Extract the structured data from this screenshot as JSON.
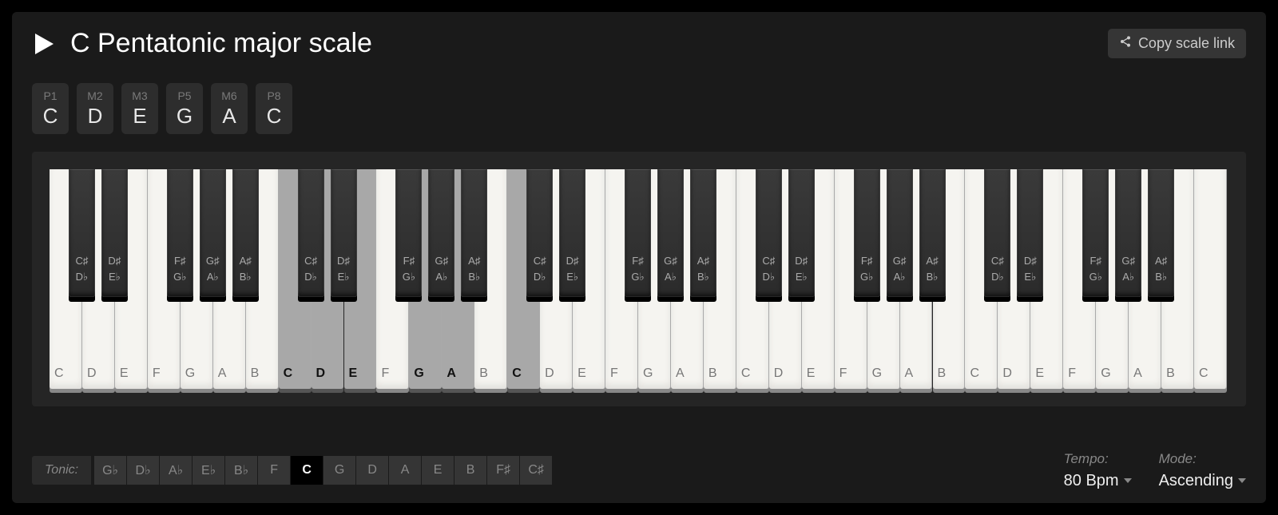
{
  "title": "C Pentatonic major scale",
  "copy_link_label": "Copy scale link",
  "intervals": [
    {
      "interval": "P1",
      "note": "C"
    },
    {
      "interval": "M2",
      "note": "D"
    },
    {
      "interval": "M3",
      "note": "E"
    },
    {
      "interval": "P5",
      "note": "G"
    },
    {
      "interval": "M6",
      "note": "A"
    },
    {
      "interval": "P8",
      "note": "C"
    }
  ],
  "keyboard": {
    "num_octaves": 5,
    "white_sequence": [
      "C",
      "D",
      "E",
      "F",
      "G",
      "A",
      "B"
    ],
    "black_after": {
      "C": [
        "C♯",
        "D♭"
      ],
      "D": [
        "D♯",
        "E♭"
      ],
      "F": [
        "F♯",
        "G♭"
      ],
      "G": [
        "G♯",
        "A♭"
      ],
      "A": [
        "A♯",
        "B♭"
      ]
    },
    "highlighted_white_indices": [
      7,
      8,
      9,
      11,
      12,
      14
    ],
    "trailing_c": "C"
  },
  "tonic": {
    "label": "Tonic:",
    "options": [
      "G♭",
      "D♭",
      "A♭",
      "E♭",
      "B♭",
      "F",
      "C",
      "G",
      "D",
      "A",
      "E",
      "B",
      "F♯",
      "C♯"
    ],
    "selected": "C"
  },
  "tempo": {
    "label": "Tempo:",
    "value": "80 Bpm"
  },
  "mode": {
    "label": "Mode:",
    "value": "Ascending"
  }
}
